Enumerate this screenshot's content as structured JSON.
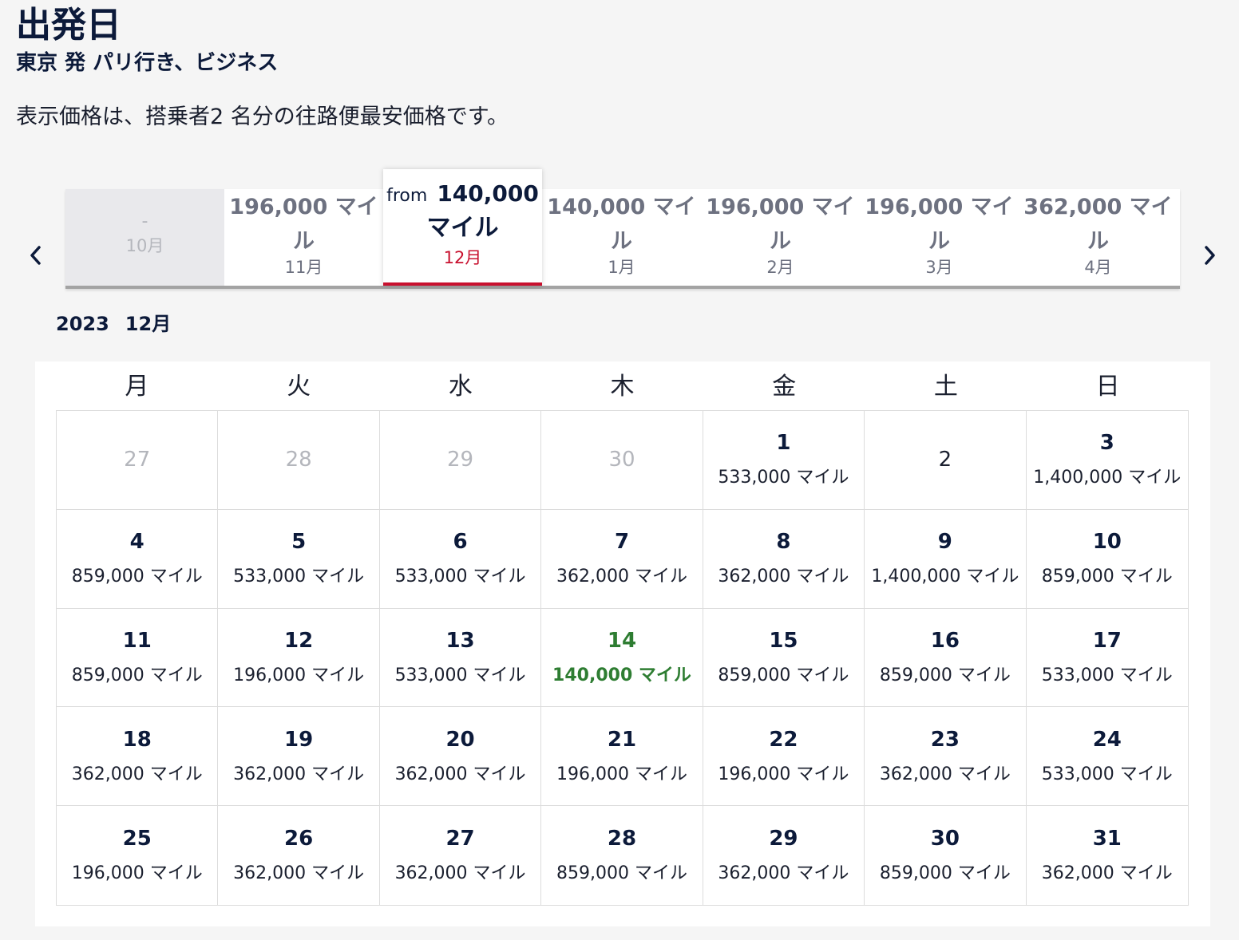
{
  "header": {
    "title": "出発日",
    "route": "東京 発 パリ行き、ビジネス",
    "note": "表示価格は、搭乗者2 名分の往路便最安価格です。"
  },
  "colors": {
    "navy": "#0c1a3a",
    "selected_accent": "#c8102e",
    "best_price": "#2e7d32",
    "muted": "#b4b6bc"
  },
  "month_nav": {
    "prev_icon": "chevron-left-icon",
    "next_icon": "chevron-right-icon",
    "months": [
      {
        "price": "-",
        "label": "10月"
      },
      {
        "price": "196,000 マイル",
        "label": "11月"
      },
      {
        "from_word": "from",
        "price": "140,000",
        "unit": "マイル",
        "label": "12月"
      },
      {
        "price": "140,000 マイル",
        "label": "1月"
      },
      {
        "price": "196,000 マイル",
        "label": "2月"
      },
      {
        "price": "196,000 マイル",
        "label": "3月"
      },
      {
        "price": "362,000 マイル",
        "label": "4月"
      }
    ]
  },
  "calendar": {
    "year": "2023",
    "month": "12月",
    "weekdays": [
      "月",
      "火",
      "水",
      "木",
      "金",
      "土",
      "日"
    ],
    "days": [
      {
        "day": "27",
        "miles": ""
      },
      {
        "day": "28",
        "miles": ""
      },
      {
        "day": "29",
        "miles": ""
      },
      {
        "day": "30",
        "miles": ""
      },
      {
        "day": "1",
        "miles": "533,000 マイル"
      },
      {
        "day": "2",
        "miles": ""
      },
      {
        "day": "3",
        "miles": "1,400,000 マイル"
      },
      {
        "day": "4",
        "miles": "859,000 マイル"
      },
      {
        "day": "5",
        "miles": "533,000 マイル"
      },
      {
        "day": "6",
        "miles": "533,000 マイル"
      },
      {
        "day": "7",
        "miles": "362,000 マイル"
      },
      {
        "day": "8",
        "miles": "362,000 マイル"
      },
      {
        "day": "9",
        "miles": "1,400,000 マイル"
      },
      {
        "day": "10",
        "miles": "859,000 マイル"
      },
      {
        "day": "11",
        "miles": "859,000 マイル"
      },
      {
        "day": "12",
        "miles": "196,000 マイル"
      },
      {
        "day": "13",
        "miles": "533,000 マイル"
      },
      {
        "day": "14",
        "miles": "140,000 マイル"
      },
      {
        "day": "15",
        "miles": "859,000 マイル"
      },
      {
        "day": "16",
        "miles": "859,000 マイル"
      },
      {
        "day": "17",
        "miles": "533,000 マイル"
      },
      {
        "day": "18",
        "miles": "362,000 マイル"
      },
      {
        "day": "19",
        "miles": "362,000 マイル"
      },
      {
        "day": "20",
        "miles": "362,000 マイル"
      },
      {
        "day": "21",
        "miles": "196,000 マイル"
      },
      {
        "day": "22",
        "miles": "196,000 マイル"
      },
      {
        "day": "23",
        "miles": "362,000 マイル"
      },
      {
        "day": "24",
        "miles": "533,000 マイル"
      },
      {
        "day": "25",
        "miles": "196,000 マイル"
      },
      {
        "day": "26",
        "miles": "362,000 マイル"
      },
      {
        "day": "27",
        "miles": "362,000 マイル"
      },
      {
        "day": "28",
        "miles": "859,000 マイル"
      },
      {
        "day": "29",
        "miles": "362,000 マイル"
      },
      {
        "day": "30",
        "miles": "859,000 マイル"
      },
      {
        "day": "31",
        "miles": "362,000 マイル"
      }
    ]
  }
}
